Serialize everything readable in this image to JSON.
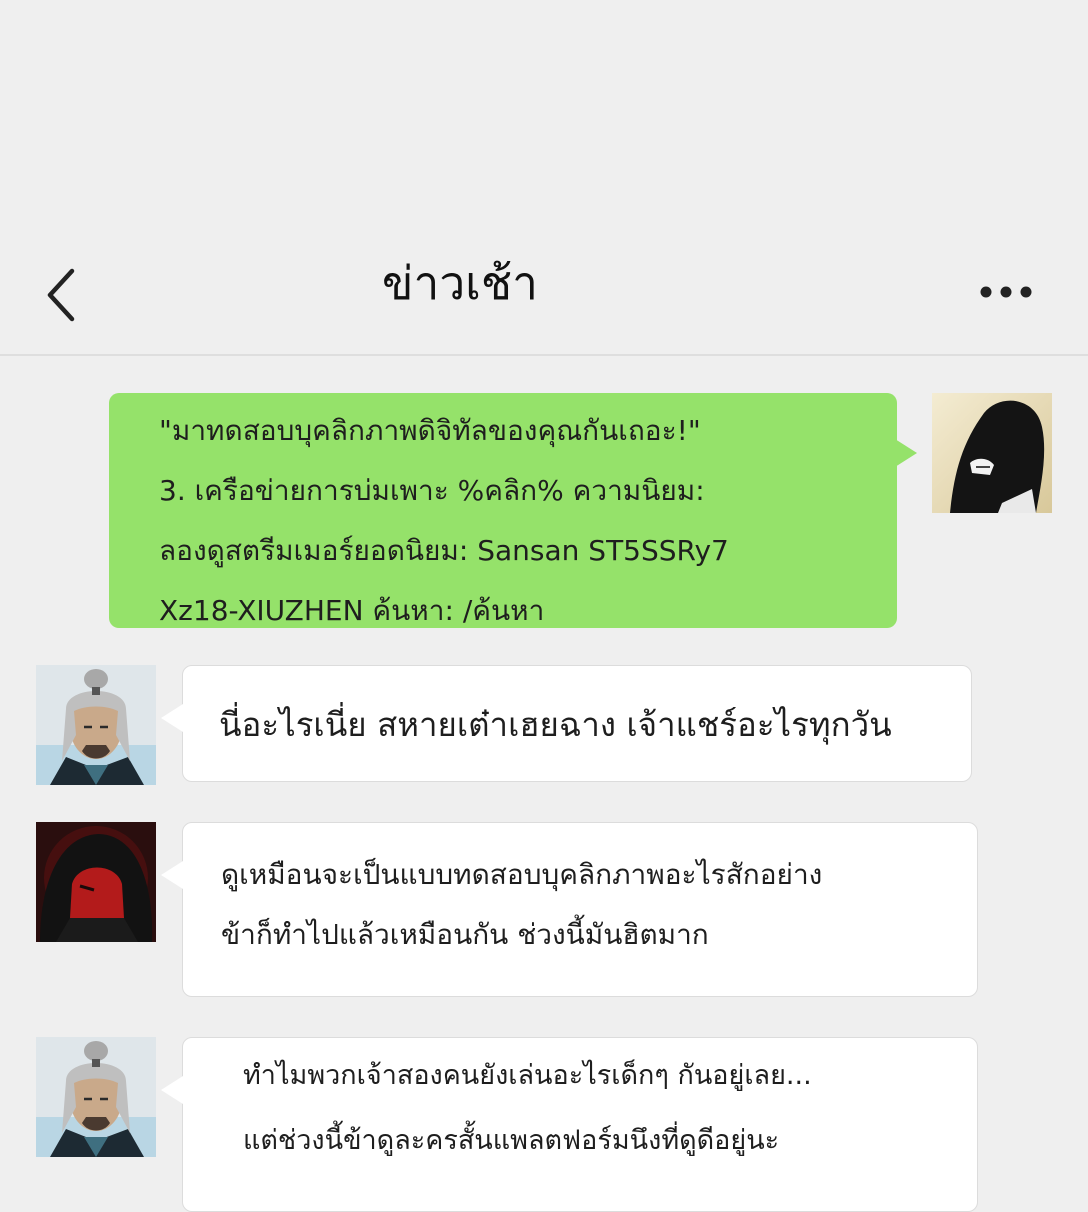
{
  "header": {
    "title": "ข่าวเช้า"
  },
  "messages": [
    {
      "sender": "me",
      "lines": [
        "\"มาทดสอบบุคลิกภาพดิจิทัลของคุณกันเถอะ!\"",
        "3. เครือข่ายการบ่มเพาะ %คลิก% ความนิยม:",
        "ลองดูสตรีมเมอร์ยอดนิยม: Sansan ST5SSRy7",
        "Xz18-XIUZHEN ค้นหา: /ค้นหา"
      ]
    },
    {
      "sender": "grey-haired",
      "lines": [
        "นี่อะไรเนี่ย สหายเต๋าเฮยฉาง เจ้าแชร์อะไรทุกวัน"
      ]
    },
    {
      "sender": "red-hooded",
      "lines": [
        "ดูเหมือนจะเป็นแบบทดสอบบุคลิกภาพอะไรสักอย่าง",
        "ข้าก็ทำไปแล้วเหมือนกัน ช่วงนี้มันฮิตมาก"
      ]
    },
    {
      "sender": "grey-haired",
      "lines": [
        "ทำไมพวกเจ้าสองคนยังเล่นอะไรเด็กๆ กันอยู่เลย...",
        "แต่ช่วงนี้ข้าดูละครสั้นแพลตฟอร์มนึงที่ดูดีอยู่นะ"
      ]
    }
  ],
  "icons": {
    "back": "chevron-left-icon",
    "more": "more-horizontal-icon"
  },
  "colors": {
    "background": "#efefef",
    "sent_bubble": "#95e26a",
    "received_bubble": "#ffffff"
  }
}
